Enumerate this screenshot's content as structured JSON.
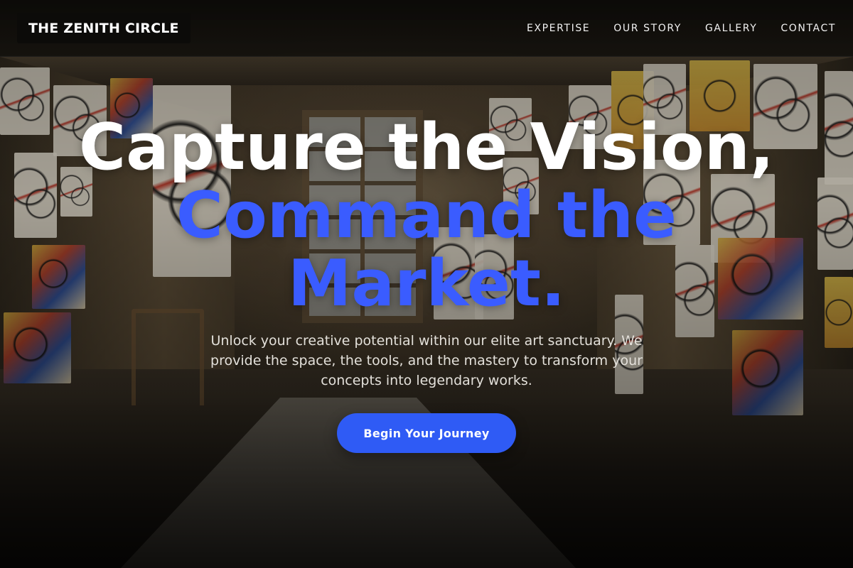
{
  "header": {
    "logo_text": "THE ZENITH CIRCLE",
    "nav": [
      {
        "label": "EXPERTISE"
      },
      {
        "label": "OUR STORY"
      },
      {
        "label": "GALLERY"
      },
      {
        "label": "CONTACT"
      }
    ]
  },
  "hero": {
    "headline_line1": "Capture the Vision,",
    "headline_accent": "Command the Market.",
    "subtext": "Unlock your creative potential within our elite art sanctuary. We provide the space, the tools, and the mastery to transform your concepts into legendary works.",
    "cta_label": "Begin Your Journey"
  },
  "colors": {
    "accent": "#2f5bf5",
    "headline_accent": "#3a5cff",
    "header_bg": "#0c0b09",
    "text_light": "#ffffff"
  }
}
